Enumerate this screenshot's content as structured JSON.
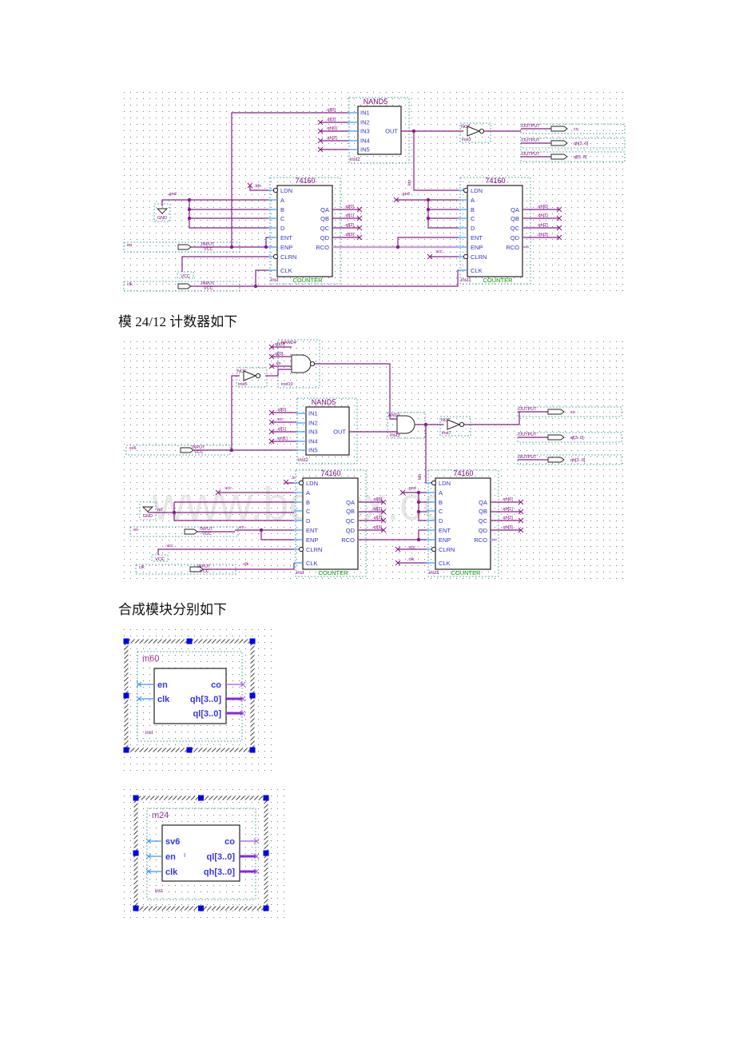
{
  "captions": {
    "mod24": "模 24/12 计数器如下",
    "modules": "合成模块分别如下"
  },
  "watermark": "www.bdocx.com",
  "counter": {
    "title": "74160",
    "type": "COUNTER",
    "left_pins": [
      "LDN",
      "A",
      "B",
      "C",
      "D",
      "ENT",
      "ENP",
      "CLRN",
      "CLK"
    ],
    "right_pins": [
      "QA",
      "QB",
      "QC",
      "QD",
      "RCO"
    ]
  },
  "nand5": {
    "title": "NAND5",
    "inputs": [
      "IN1",
      "IN2",
      "IN3",
      "IN4",
      "IN5"
    ],
    "output": "OUT"
  },
  "pins": {
    "input": "INPUT",
    "vcc_sub": "VCC",
    "output": "OUTPUT",
    "gnd": "GND",
    "vcc": "VCC",
    "not": "NOT",
    "nand4": "NAND4",
    "and2": "AND2"
  },
  "schematic1": {
    "nand_inputs": [
      ".ql[0]",
      ".ql[3]",
      ".qh[0]",
      ".qh[2]",
      ""
    ],
    "nand_inst": "inst2",
    "not_inst": "inst3",
    "outputs": [
      "co",
      "qh[3..0]",
      "ql[3..0]"
    ],
    "inputs": [
      "en",
      "clk"
    ],
    "counter1": {
      "inst": "inst",
      "ldn": ".ldn",
      "gnd": ".gnd",
      "q": [
        ".ql[0]",
        ".ql[1]",
        ".ql[2]",
        ".ql[3]"
      ]
    },
    "counter2": {
      "inst": "inst1",
      "ldn": "ldn",
      "gnd": ".gnd",
      "vcc": ".vcc",
      "q": [
        ".qh[0]",
        ".qh[1]",
        ".qh[2]",
        ".qh[3]"
      ]
    }
  },
  "schematic2": {
    "nand4_inputs": [
      "qh[0]",
      "ql[0]",
      ".en"
    ],
    "nand4_inst": "inst10",
    "not1_inst": "inst5",
    "nand5_inputs": [
      ".ql[0]",
      ".en",
      ".ql[1]",
      ".qh[1]"
    ],
    "nand5_inst": "inst2",
    "and_inst": "inst3",
    "not2_inst": "inst7",
    "outputs": [
      "co",
      "ql[3..0]",
      "qh[3..0]"
    ],
    "inputs": [
      "sv6",
      "en",
      "clk"
    ],
    "counter1": {
      "inst": "inst",
      "ldn": ".lc",
      "vcc": ".vcc",
      "gnd": "nd",
      "en": ".en",
      "vcc2": ".vcc",
      "clk": ".clk",
      "q": [
        ".ql[0]",
        ".ql[1]",
        ".ql[2]",
        ".ql[3]"
      ]
    },
    "counter2": {
      "inst": "inst1",
      "ldn": "ldn",
      "gnd": ".gnd",
      "vcc": ".vcc",
      "clk": ".clk",
      "q": [
        ".qh[0]",
        ".qh[1]",
        ".qh[2]",
        ".qh[3]"
      ]
    }
  },
  "module_m60": {
    "name": "m60",
    "inst": "inst",
    "inputs": [
      "en",
      "clk"
    ],
    "outputs": [
      "co",
      "qh[3..0]",
      "ql[3..0]"
    ]
  },
  "module_m24": {
    "name": "m24",
    "inst": "inst",
    "inputs": [
      "sv6",
      "en",
      "clk"
    ],
    "outputs": [
      "co",
      "ql[3..0]",
      "qh[3..0]"
    ],
    "cursor": "I"
  }
}
